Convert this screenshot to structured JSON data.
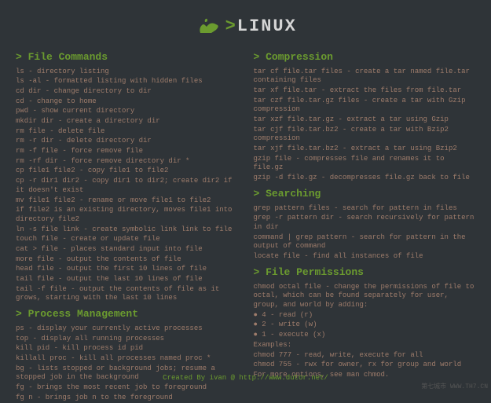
{
  "header": {
    "prefix": ">",
    "title": "LINUX"
  },
  "sections": [
    {
      "title": "File Commands",
      "col": 0,
      "lines": [
        "ls - directory listing",
        "ls -al - formatted listing with hidden files",
        "cd dir - change directory to dir",
        "cd - change to home",
        "pwd - show current directory",
        "mkdir dir - create a directory dir",
        "rm file - delete file",
        "rm -r dir - delete directory dir",
        "rm -f file - force remove file",
        "rm -rf dir - force remove directory dir *",
        "cp file1 file2 - copy file1 to file2",
        "cp -r dir1 dir2 - copy dir1 to dir2; create dir2 if it doesn't exist",
        "mv file1 file2 - rename or move file1 to file2",
        "if file2 is an existing directory, moves file1 into directory file2",
        "ln -s file link - create symbolic link link to file",
        "touch file - create or update file",
        "cat > file - places standard input into file",
        "more file - output the contents of file",
        "head file - output the first 10 lines of file",
        "tail file - output the last 10 lines of file",
        "tail -f file - output the contents of file as it grows, starting with the last 10 lines"
      ]
    },
    {
      "title": "Process Management",
      "col": 0,
      "lines": [
        "ps - display your currently active processes",
        "top - display all running processes",
        "kill pid - kill process id pid",
        "killall proc - kill all processes named proc *",
        "bg - lists stopped or background jobs; resume a stopped job in the background",
        "fg - brings the most recent job to foreground",
        "fg n - brings job n to the foreground"
      ]
    },
    {
      "title": "Compression",
      "col": 1,
      "lines": [
        "tar cf file.tar files - create a tar named file.tar containing files",
        "tar xf file.tar - extract the files from file.tar",
        "tar czf file.tar.gz files - create a tar with Gzip compression",
        "tar xzf file.tar.gz - extract a tar using Gzip",
        "tar cjf file.tar.bz2 - create a tar with Bzip2 compression",
        "tar xjf file.tar.bz2 - extract a tar using Bzip2",
        "gzip file - compresses file and renames it to file.gz",
        "gzip -d file.gz - decompresses file.gz back to file"
      ]
    },
    {
      "title": "Searching",
      "col": 1,
      "lines": [
        "grep pattern files - search for pattern in files",
        "grep -r pattern dir - search recursively for pattern in dir",
        "command | grep pattern - search for pattern in the output of command",
        "locate file - find all instances of file"
      ]
    },
    {
      "title": "File Permissions",
      "col": 1,
      "lines": [
        "chmod octal file - change the permissions of file to octal, which can be found separately for user, group, and world by adding:",
        "● 4 - read (r)",
        "● 2 - write (w)",
        "● 1 - execute (x)",
        "Examples:",
        "chmod 777 - read, write, execute for all",
        "chmod 755 - rwx for owner, rx for group and world",
        "For more options, see man chmod."
      ]
    }
  ],
  "footer": "Created By ivan @ http://www.dutor.net/",
  "watermark": "第七城市  WWW.TH7.CN"
}
